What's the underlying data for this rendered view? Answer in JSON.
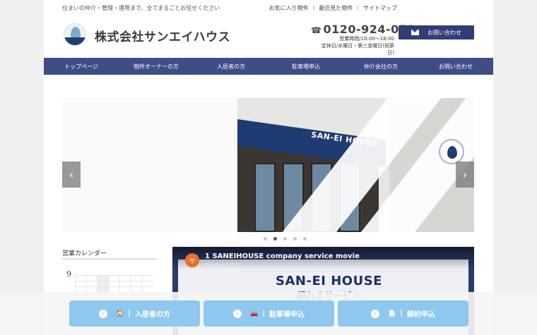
{
  "header": {
    "tagline": "住まいの仲介・管理・運用まで、全てまるごとお任せください",
    "links": [
      "お気に入り物件",
      "最近見た物件",
      "サイトマップ"
    ],
    "company_name": "株式会社サンエイハウス",
    "phone": "0120-924-053",
    "hours_line1": "営業時間/10:00〜18:00",
    "hours_line2": "定休日/水曜日・第三金曜日(祝祭日)",
    "contact_button": "お問い合わせ"
  },
  "nav": {
    "items": [
      "トップページ",
      "物件オーナーの方",
      "入居者の方",
      "駐車場申込",
      "仲介会社の方",
      "お問い合わせ"
    ]
  },
  "slider": {
    "sign_text": "SAN-EI HOUSE",
    "prev_label": "‹",
    "next_label": "›",
    "dot_count": 5,
    "active_dot": 1
  },
  "calendar": {
    "title": "営業カレンダー",
    "month": "9"
  },
  "video": {
    "avatar_letter": "サ",
    "title": "1 SANEIHOUSE company service movie",
    "channel": "サンエイハウス",
    "brand": "SAN-EI HOUSE",
    "subtitle": "頼れるサービス"
  },
  "floating_buttons": [
    {
      "icon": "🏠",
      "label": "入居者の方"
    },
    {
      "icon": "🚗",
      "label": "駐車場申込"
    },
    {
      "icon": "📄",
      "label": "解約申込"
    }
  ],
  "colors": {
    "nav": "#3f4d87",
    "contact_button": "#323d78",
    "float_button": "#8ec8ee"
  }
}
